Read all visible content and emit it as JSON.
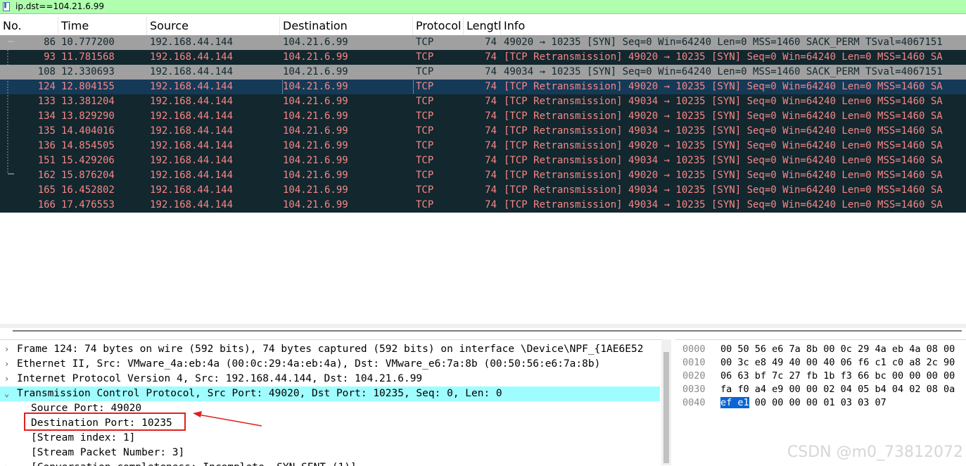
{
  "filter": {
    "text": "ip.dst==104.21.6.99"
  },
  "columns": [
    "No.",
    "Time",
    "Source",
    "Destination",
    "Protocol",
    "Lengtl",
    "Info"
  ],
  "packets": [
    {
      "no": "86",
      "time": "10.777200",
      "src": "192.168.44.144",
      "dst": "104.21.6.99",
      "proto": "TCP",
      "len": "74",
      "info": "49020 → 10235 [SYN] Seq=0 Win=64240 Len=0 MSS=1460 SACK_PERM TSval=4067151",
      "style": "gray"
    },
    {
      "no": "93",
      "time": "11.781568",
      "src": "192.168.44.144",
      "dst": "104.21.6.99",
      "proto": "TCP",
      "len": "74",
      "info": "[TCP Retransmission] 49020 → 10235 [SYN] Seq=0 Win=64240 Len=0 MSS=1460 SA",
      "style": "dark"
    },
    {
      "no": "108",
      "time": "12.330693",
      "src": "192.168.44.144",
      "dst": "104.21.6.99",
      "proto": "TCP",
      "len": "74",
      "info": "49034 → 10235 [SYN] Seq=0 Win=64240 Len=0 MSS=1460 SACK_PERM TSval=4067151",
      "style": "gray"
    },
    {
      "no": "124",
      "time": "12.804155",
      "src": "192.168.44.144",
      "dst": "104.21.6.99",
      "proto": "TCP",
      "len": "74",
      "info": "[TCP Retransmission] 49020 → 10235 [SYN] Seq=0 Win=64240 Len=0 MSS=1460 SA",
      "style": "sel"
    },
    {
      "no": "133",
      "time": "13.381204",
      "src": "192.168.44.144",
      "dst": "104.21.6.99",
      "proto": "TCP",
      "len": "74",
      "info": "[TCP Retransmission] 49034 → 10235 [SYN] Seq=0 Win=64240 Len=0 MSS=1460 SA",
      "style": "dark"
    },
    {
      "no": "134",
      "time": "13.829290",
      "src": "192.168.44.144",
      "dst": "104.21.6.99",
      "proto": "TCP",
      "len": "74",
      "info": "[TCP Retransmission] 49020 → 10235 [SYN] Seq=0 Win=64240 Len=0 MSS=1460 SA",
      "style": "dark"
    },
    {
      "no": "135",
      "time": "14.404016",
      "src": "192.168.44.144",
      "dst": "104.21.6.99",
      "proto": "TCP",
      "len": "74",
      "info": "[TCP Retransmission] 49034 → 10235 [SYN] Seq=0 Win=64240 Len=0 MSS=1460 SA",
      "style": "dark"
    },
    {
      "no": "136",
      "time": "14.854505",
      "src": "192.168.44.144",
      "dst": "104.21.6.99",
      "proto": "TCP",
      "len": "74",
      "info": "[TCP Retransmission] 49020 → 10235 [SYN] Seq=0 Win=64240 Len=0 MSS=1460 SA",
      "style": "dark"
    },
    {
      "no": "151",
      "time": "15.429206",
      "src": "192.168.44.144",
      "dst": "104.21.6.99",
      "proto": "TCP",
      "len": "74",
      "info": "[TCP Retransmission] 49034 → 10235 [SYN] Seq=0 Win=64240 Len=0 MSS=1460 SA",
      "style": "dark"
    },
    {
      "no": "162",
      "time": "15.876204",
      "src": "192.168.44.144",
      "dst": "104.21.6.99",
      "proto": "TCP",
      "len": "74",
      "info": "[TCP Retransmission] 49020 → 10235 [SYN] Seq=0 Win=64240 Len=0 MSS=1460 SA",
      "style": "dark"
    },
    {
      "no": "165",
      "time": "16.452802",
      "src": "192.168.44.144",
      "dst": "104.21.6.99",
      "proto": "TCP",
      "len": "74",
      "info": "[TCP Retransmission] 49034 → 10235 [SYN] Seq=0 Win=64240 Len=0 MSS=1460 SA",
      "style": "dark"
    },
    {
      "no": "166",
      "time": "17.476553",
      "src": "192.168.44.144",
      "dst": "104.21.6.99",
      "proto": "TCP",
      "len": "74",
      "info": "[TCP Retransmission] 49034 → 10235 [SYN] Seq=0 Win=64240 Len=0 MSS=1460 SA",
      "style": "dark"
    }
  ],
  "details": [
    {
      "arrow": "›",
      "indent": 0,
      "text": "Frame 124: 74 bytes on wire (592 bits), 74 bytes captured (592 bits) on interface \\Device\\NPF_{1AE6E52",
      "hl": false
    },
    {
      "arrow": "›",
      "indent": 0,
      "text": "Ethernet II, Src: VMware_4a:eb:4a (00:0c:29:4a:eb:4a), Dst: VMware_e6:7a:8b (00:50:56:e6:7a:8b)",
      "hl": false
    },
    {
      "arrow": "›",
      "indent": 0,
      "text": "Internet Protocol Version 4, Src: 192.168.44.144, Dst: 104.21.6.99",
      "hl": false
    },
    {
      "arrow": "⌄",
      "indent": 0,
      "text": "Transmission Control Protocol, Src Port: 49020, Dst Port: 10235, Seq: 0, Len: 0",
      "hl": true
    },
    {
      "arrow": "",
      "indent": 1,
      "text": "Source Port: 49020",
      "hl": false
    },
    {
      "arrow": "",
      "indent": 1,
      "text": "Destination Port: 10235",
      "hl": false
    },
    {
      "arrow": "",
      "indent": 1,
      "text": "[Stream index: 1]",
      "hl": false
    },
    {
      "arrow": "",
      "indent": 1,
      "text": "[Stream Packet Number: 3]",
      "hl": false
    },
    {
      "arrow": "›",
      "indent": 1,
      "text": "[Conversation completeness: Incomplete, SYN_SENT (1)]",
      "hl": false
    }
  ],
  "bytes": [
    {
      "offset": "0000",
      "hex_a": "00 50 56 e6 7a 8b 00 0c",
      "hex_b": "29 4a eb 4a 08 00",
      "sel": ""
    },
    {
      "offset": "0010",
      "hex_a": "00 3c e8 49 40 00 40 06",
      "hex_b": "f6 c1 c0 a8 2c 90",
      "sel": ""
    },
    {
      "offset": "0020",
      "hex_a": "06 63 bf 7c 27 fb 1b f3",
      "hex_b": "66 bc 00 00 00 00",
      "sel": ""
    },
    {
      "offset": "0030",
      "hex_a": "fa f0 a4 e9 00 00 02 04",
      "hex_b": "05 b4 04 02 08 0a",
      "sel": ""
    },
    {
      "offset": "0040",
      "hex_a": "00 00 00 00 01 03",
      "hex_b": "03 07",
      "sel": "ef e1"
    }
  ],
  "watermark": "CSDN @m0_73812072",
  "colors": {
    "filter_bg": "#afffaf",
    "row_gray": "#a0a0a0",
    "row_dark": "#12272e",
    "row_text": "#f78787",
    "highlight": "#a0fdff",
    "annotation": "#e02020"
  }
}
